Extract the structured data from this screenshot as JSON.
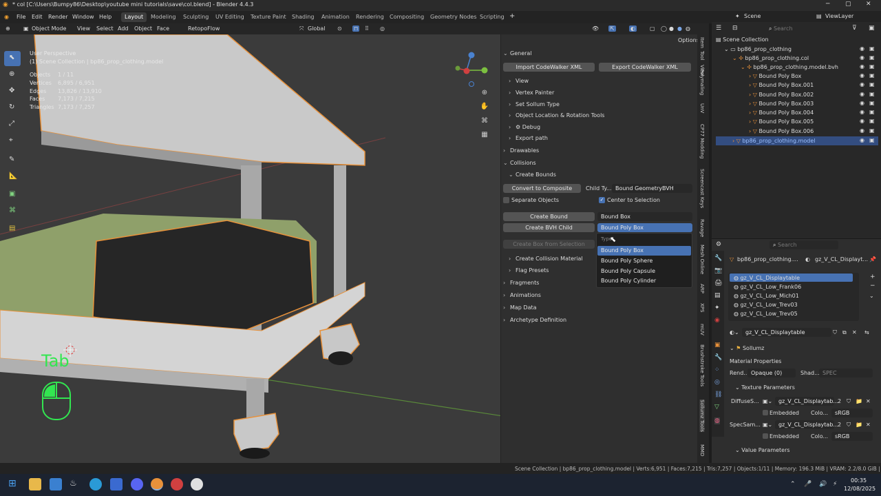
{
  "window": {
    "title": "* col [C:\\Users\\Bumpy86\\Desktop\\youtube mini tutorials\\save\\col.blend] - Blender 4.4.3"
  },
  "menu": [
    "File",
    "Edit",
    "Render",
    "Window",
    "Help"
  ],
  "workspaces": [
    "Layout",
    "Modeling",
    "Sculpting",
    "UV Editing",
    "Texture Paint",
    "Shading",
    "Animation",
    "Rendering",
    "Compositing",
    "Geometry Nodes",
    "Scripting"
  ],
  "scene": {
    "name": "Scene",
    "view_layer": "ViewLayer"
  },
  "viewport_header": {
    "mode": "Object Mode",
    "items": [
      "View",
      "Select",
      "Add",
      "Object",
      "Face"
    ],
    "addon": "RetopoFlow",
    "transform": "Global",
    "options": "Options"
  },
  "viewport_overlay": {
    "perspective": "User Perspective",
    "collection": "(1) Scene Collection | bp86_prop_clothing.model",
    "stats": [
      {
        "label": "Objects",
        "value": "1 / 11"
      },
      {
        "label": "Vertices",
        "value": "6,895 / 6,951"
      },
      {
        "label": "Edges",
        "value": "13,826 / 13,910"
      },
      {
        "label": "Faces",
        "value": "7,173 / 7,215"
      },
      {
        "label": "Triangles",
        "value": "7,173 / 7,257"
      }
    ],
    "key_hint": "Tab"
  },
  "sidebar": {
    "general": "General",
    "import_btn": "Import CodeWalker XML",
    "export_btn": "Export CodeWalker XML",
    "sub_items": [
      "View",
      "Vertex Painter",
      "Set Sollum Type",
      "Object Location & Rotation Tools",
      "Debug",
      "Export path"
    ],
    "drawables": "Drawables",
    "collisions": "Collisions",
    "create_bounds": "Create Bounds",
    "convert_btn": "Convert to Composite",
    "child_type_label": "Child Ty...",
    "child_type_value": "Bound GeometryBVH",
    "separate_objects": "Separate Objects",
    "center_selection": "Center to Selection",
    "create_bound_btn": "Create Bound",
    "create_bound_value": "Bound Box",
    "create_bvh_btn": "Create BVH Child",
    "create_bvh_value": "Bound Poly Box",
    "create_box_btn": "Create Box from Selection",
    "collision_material": "Create Collision Material",
    "flag_presets": "Flag Presets",
    "fragments": "Fragments",
    "animations": "Animations",
    "map_data": "Map Data",
    "archetype": "Archetype Definition",
    "dropdown": {
      "header": "Type",
      "options": [
        "Bound Poly Box",
        "Bound Poly Sphere",
        "Bound Poly Capsule",
        "Bound Poly Cylinder"
      ]
    }
  },
  "n_tabs": [
    "Item",
    "Tool",
    "View",
    "Polymaling",
    "UnV",
    "CP77 Modding",
    "Screencast Keys",
    "Ravage",
    "Mesh Online",
    "ARP",
    "XPS",
    "mUV",
    "Brushstroke Tools",
    "Sollumz Tools",
    "MMD"
  ],
  "outliner": {
    "search_placeholder": "Search",
    "rows": [
      {
        "label": "Scene Collection",
        "indent": 0,
        "selected": false
      },
      {
        "label": "bp86_prop_clothing",
        "indent": 1,
        "selected": false
      },
      {
        "label": "bp86_prop_clothing.col",
        "indent": 2,
        "selected": false
      },
      {
        "label": "bp86_prop_clothing.model.bvh",
        "indent": 3,
        "selected": false
      },
      {
        "label": "Bound Poly Box",
        "indent": 4,
        "selected": false
      },
      {
        "label": "Bound Poly Box.001",
        "indent": 4,
        "selected": false
      },
      {
        "label": "Bound Poly Box.002",
        "indent": 4,
        "selected": false
      },
      {
        "label": "Bound Poly Box.003",
        "indent": 4,
        "selected": false
      },
      {
        "label": "Bound Poly Box.004",
        "indent": 4,
        "selected": false
      },
      {
        "label": "Bound Poly Box.005",
        "indent": 4,
        "selected": false
      },
      {
        "label": "Bound Poly Box.006",
        "indent": 4,
        "selected": false
      },
      {
        "label": "bp86_prop_clothing.model",
        "indent": 2,
        "selected": true
      }
    ]
  },
  "properties": {
    "search_placeholder": "Search",
    "breadcrumb_obj": "bp86_prop_clothing....",
    "breadcrumb_mat": "gz_V_CL_Displayt...",
    "materials": [
      "gz_V_CL_Displaytable",
      "gz_V_CL_Low_Frank06",
      "gz_V_CL_Low_Mich01",
      "gz_V_CL_Low_Trev03",
      "gz_V_CL_Low_Trev05"
    ],
    "material_name": "gz_V_CL_Displaytable",
    "sollumz": "Sollumz",
    "material_properties": "Material Properties",
    "render_label": "Rend...",
    "render_value": "Opaque (0)",
    "shader_label": "Shad...",
    "shader_value": "SPEC",
    "texture_params": "Texture Parameters",
    "diffuse_label": "DiffuseS...",
    "diffuse_value": "gz_V_CL_Displaytab...",
    "diffuse_users": "2",
    "embedded": "Embedded",
    "color_label": "Colo...",
    "color_value": "sRGB",
    "spec_label": "SpecSam...",
    "spec_value": "gz_V_CL_Displaytab...",
    "spec_users": "2",
    "value_params": "Value Parameters"
  },
  "statusbar": "Scene Collection | bp86_prop_clothing.model | Verts:6,951 | Faces:7,215 | Tris:7,257 | Objects:1/11 | Memory: 196.3 MiB | VRAM: 2.2/8.0 GiB | 4.4.3",
  "taskbar": {
    "time": "00:35",
    "date": "12/08/2025"
  },
  "colors": {
    "accent": "#4772b3",
    "selection_outline": "#e8913a",
    "hint_green": "#32e650"
  }
}
